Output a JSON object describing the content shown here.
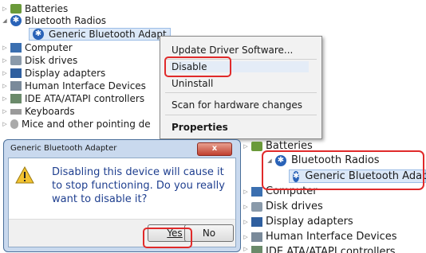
{
  "tree_top": {
    "items": [
      {
        "label": "Batteries"
      },
      {
        "label": "Bluetooth Radios"
      },
      {
        "label": "Generic Bluetooth Adapt"
      },
      {
        "label": "Computer"
      },
      {
        "label": "Disk drives"
      },
      {
        "label": "Display adapters"
      },
      {
        "label": "Human Interface Devices"
      },
      {
        "label": "IDE ATA/ATAPI controllers"
      },
      {
        "label": "Keyboards"
      },
      {
        "label": "Mice and other pointing de"
      }
    ]
  },
  "context_menu": {
    "update": "Update Driver Software...",
    "disable": "Disable",
    "uninstall": "Uninstall",
    "scan": "Scan for hardware changes",
    "properties": "Properties"
  },
  "dialog": {
    "title": "Generic Bluetooth Adapter",
    "message": "Disabling this device will cause it to stop functioning. Do you really want to disable it?",
    "yes_label": "Yes",
    "no_label": "No",
    "close_label": "x"
  },
  "tree_bottom": {
    "items": [
      {
        "label": "Batteries"
      },
      {
        "label": "Bluetooth Radios"
      },
      {
        "label": "Generic Bluetooth Adapter"
      },
      {
        "label": "Computer"
      },
      {
        "label": "Disk drives"
      },
      {
        "label": "Display adapters"
      },
      {
        "label": "Human Interface Devices"
      },
      {
        "label": "IDE ATA/ATAPI controllers"
      }
    ]
  },
  "icons": {
    "bluetooth_glyph": "✱",
    "warning_glyph": "!"
  },
  "colors": {
    "highlight": "#e02a2a",
    "bluetooth": "#2a63b8"
  }
}
